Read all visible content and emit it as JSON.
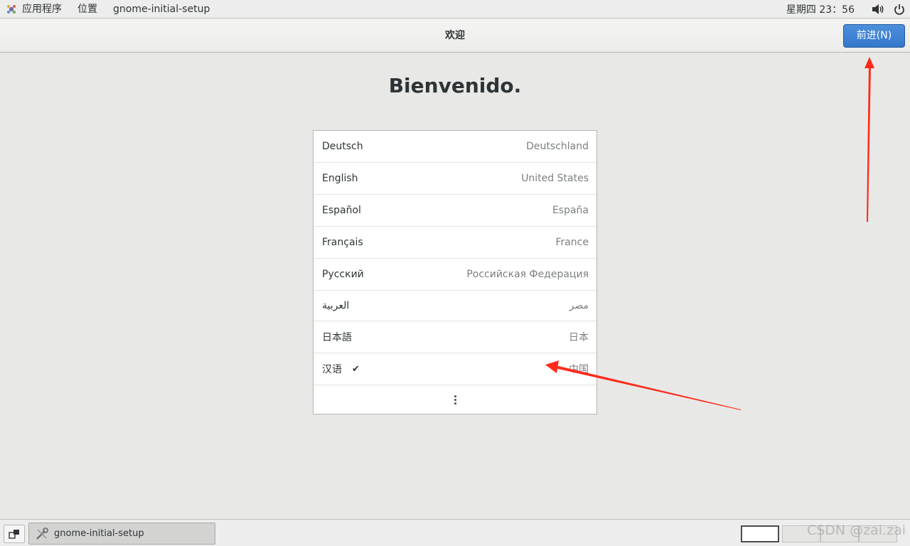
{
  "top_panel": {
    "apps_menu": "应用程序",
    "places_menu": "位置",
    "active_app": "gnome-initial-setup",
    "clock": "星期四 23：56",
    "volume_icon": "volume-icon",
    "power_icon": "power-icon"
  },
  "header": {
    "title": "欢迎",
    "next_button": "前进(N)"
  },
  "welcome_title": "Bienvenido.",
  "languages": [
    {
      "name": "Deutsch",
      "region": "Deutschland",
      "selected": false
    },
    {
      "name": "English",
      "region": "United States",
      "selected": false
    },
    {
      "name": "Español",
      "region": "España",
      "selected": false
    },
    {
      "name": "Français",
      "region": "France",
      "selected": false
    },
    {
      "name": "Русский",
      "region": "Российская Федерация",
      "selected": false
    },
    {
      "name": "العربية",
      "region": "مصر",
      "selected": false
    },
    {
      "name": "日本語",
      "region": "日本",
      "selected": false
    },
    {
      "name": "汉语",
      "region": "中国",
      "selected": true
    }
  ],
  "check_mark": "✔",
  "taskbar": {
    "task_label": "gnome-initial-setup"
  },
  "watermark": "CSDN @zai.zai",
  "colors": {
    "accent": "#3478cc",
    "annotation_arrow": "#ff2a1a"
  }
}
